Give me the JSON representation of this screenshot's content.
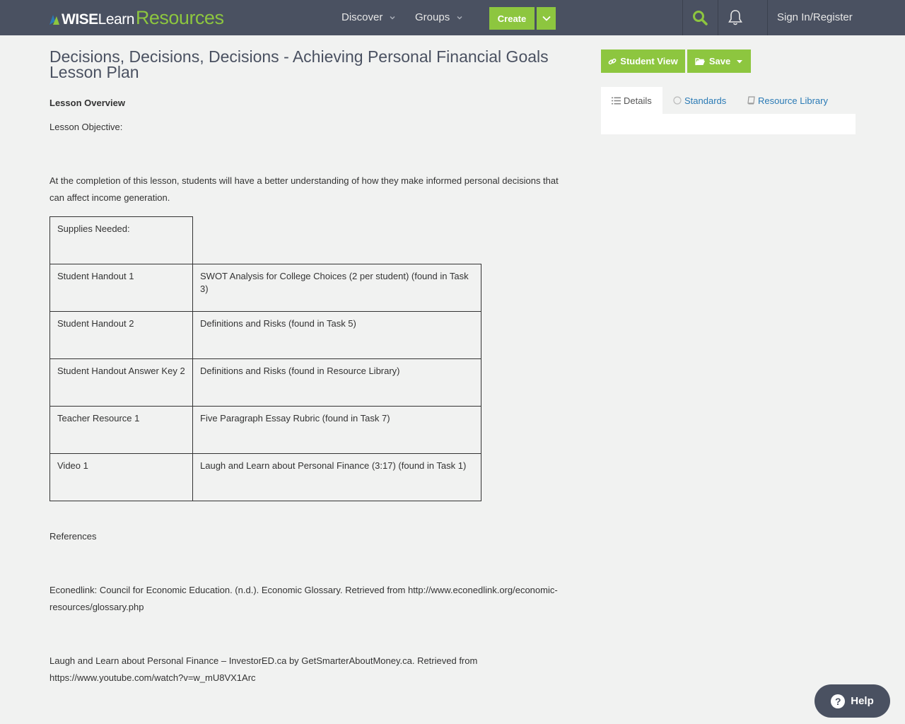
{
  "nav": {
    "logo": {
      "wise": "WISE",
      "learn": "Learn",
      "resources": "Resources"
    },
    "discover": "Discover",
    "groups": "Groups",
    "create": "Create",
    "signin": "Sign In/Register"
  },
  "title": "Decisions, Decisions, Decisions - Achieving Personal Financial Goals Lesson Plan",
  "overview_heading": "Lesson Overview",
  "objective_label": "Lesson Objective:",
  "objective_text": "At the completion of this lesson, students will have a better understanding of how they make informed personal decisions that can affect income generation.",
  "supplies_label": "Supplies Needed:",
  "supplies": [
    {
      "item": "Student Handout 1",
      "desc": "SWOT Analysis for College Choices (2 per student) (found in Task 3)"
    },
    {
      "item": "Student Handout 2",
      "desc": "Definitions and Risks (found in Task 5)"
    },
    {
      "item": "Student Handout Answer Key 2",
      "desc": "Definitions and Risks (found in Resource Library)"
    },
    {
      "item": "Teacher Resource 1",
      "desc": "Five Paragraph Essay Rubric (found in Task 7)"
    },
    {
      "item": "Video 1",
      "desc": "Laugh and Learn about Personal Finance (3:17) (found in Task 1)"
    }
  ],
  "references_label": "References",
  "references": [
    "Econedlink: Council for Economic Education. (n.d.). Economic Glossary. Retrieved from http://www.econedlink.org/economic-resources/glossary.php",
    "Laugh and Learn about Personal Finance – InvestorED.ca by GetSmarterAboutMoney.ca. Retrieved from https://www.youtube.com/watch?v=w_mU8VX1Arc"
  ],
  "side": {
    "student_view": "Student View",
    "save": "Save",
    "tabs": [
      "Details",
      "Standards",
      "Resource Library"
    ]
  },
  "help": "Help",
  "colors": {
    "nav_bg": "#4a5161",
    "accent_green": "#8dc63f",
    "link_blue": "#2a7ab5",
    "page_bg": "#f1f2f1"
  }
}
